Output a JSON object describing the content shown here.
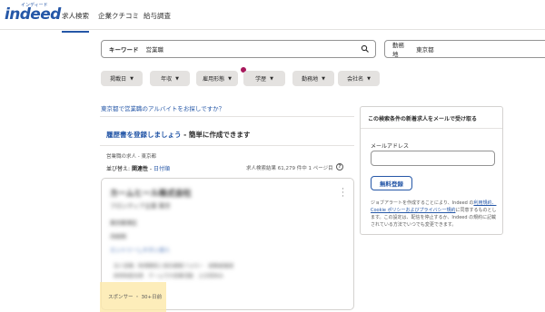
{
  "header": {
    "logo_text": "indeed",
    "logo_sub": "インディード",
    "nav": [
      {
        "label": "求人検索",
        "active": true
      },
      {
        "label": "企業クチコミ",
        "active": false
      },
      {
        "label": "給与調査",
        "active": false
      }
    ]
  },
  "search": {
    "what_label": "キーワード",
    "what_value": "営業職",
    "where_label": "勤務地",
    "where_value": "東京都"
  },
  "filters": [
    {
      "label": "掲載日"
    },
    {
      "label": "年収"
    },
    {
      "label": "雇用形態"
    },
    {
      "label": "学歴"
    },
    {
      "label": "勤務地"
    },
    {
      "label": "会社名"
    }
  ],
  "colors": {
    "accent": "#2557a7",
    "dot": "#a8185c",
    "highlight": "#fde9a9"
  },
  "results": {
    "question_link": "東京都で営業職のアルバイトをお探しですか？",
    "cv_link": "履歴書を登録しましょう",
    "cv_suffix": " - 簡単に作成できます",
    "breadcrumb": "営業職の求人 - 東京都",
    "sort_prefix": "並び替え: ",
    "sort_current": "関連性",
    "sort_sep": " - ",
    "sort_alt": "日付順",
    "count_text": "求人検索結果 61,279 件中 1 ページ目",
    "help_symbol": "?"
  },
  "job_card": {
    "title": "カームヒール株式会社",
    "company": "フロンティア企業 東京",
    "location": "東京都港区",
    "salary": "月給制",
    "feature": "エントリーしやすい求人",
    "desc_1": "法人営業／新規開拓と既存顧客フォロー　経験者優遇",
    "desc_2": "研修制度充実　チームでの営業活動　土日祝休み",
    "sponsor_text": "スポンサー ・ 30+日前"
  },
  "alert": {
    "title": "この検索条件の新着求人をメールで受け取る",
    "email_label": "メールアドレス",
    "email_placeholder": "",
    "button": "無料登録",
    "note_1": "ジョブアラートを作成することにより、Indeed の",
    "note_link": "利用規約、Cookie ポリシーおよびプライバシー規約",
    "note_2": "に同意するものとします。この設定は、配信を停止するか、Indeed の規約に記載されている方法でいつでも変更できます。"
  }
}
